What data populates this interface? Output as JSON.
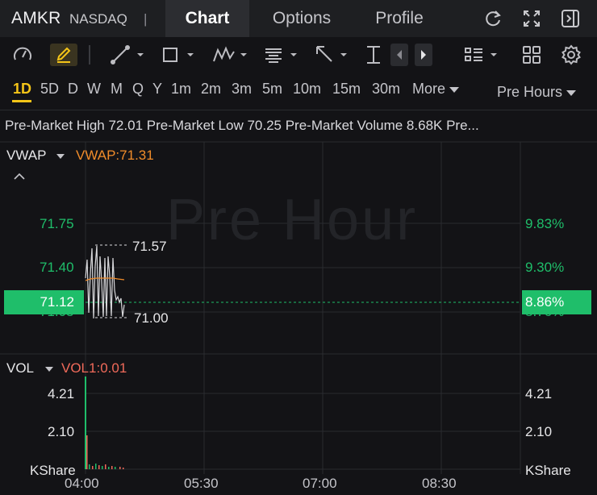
{
  "header": {
    "ticker": "AMKR",
    "exchange": "NASDAQ",
    "separator": "|",
    "tabs": [
      {
        "label": "Chart",
        "active": true
      },
      {
        "label": "Options",
        "active": false
      },
      {
        "label": "Profile",
        "active": false
      }
    ],
    "icons": [
      "refresh-icon",
      "fullscreen-icon",
      "collapse-panel-icon"
    ]
  },
  "toolbar": {
    "icons": [
      "speedometer-icon",
      "pen-icon",
      "line-tool-icon",
      "rectangle-tool-icon",
      "pattern-tool-icon",
      "text-tool-icon",
      "arrow-tool-icon",
      "measure-tool-icon",
      "prev-icon",
      "next-icon",
      "layout-list-icon",
      "grid-icon",
      "settings-icon"
    ]
  },
  "timeframes": {
    "items": [
      "1D",
      "5D",
      "D",
      "W",
      "M",
      "Q",
      "Y",
      "1m",
      "2m",
      "3m",
      "5m",
      "10m",
      "15m",
      "30m",
      "More"
    ],
    "active": "1D",
    "session": "Pre Hours"
  },
  "stats": {
    "text": "Pre-Market High 72.01 Pre-Market Low 70.25 Pre-Market Volume 8.68K Pre..."
  },
  "main_panel": {
    "indicator_name": "VWAP",
    "indicator_value": "VWAP:71.31",
    "watermark": "Pre Hour",
    "left_axis": [
      "71.75",
      "71.40",
      "71.05"
    ],
    "right_axis": [
      "9.83%",
      "9.30%",
      "8.76%"
    ],
    "current_price": "71.12",
    "current_change": "8.86%",
    "high_label": "71.57",
    "low_label": "71.00"
  },
  "volume_panel": {
    "indicator_name": "VOL",
    "indicator_value": "VOL1:0.01",
    "left_axis": [
      "4.21",
      "2.10",
      "KShare"
    ],
    "right_axis": [
      "4.21",
      "2.10",
      "KShare"
    ]
  },
  "time_axis": [
    "04:00",
    "05:30",
    "07:00",
    "08:30"
  ],
  "colors": {
    "accent": "#f5c518",
    "up": "#1fbe6a",
    "vwap": "#f08c2a",
    "vol": "#f06a5a"
  }
}
